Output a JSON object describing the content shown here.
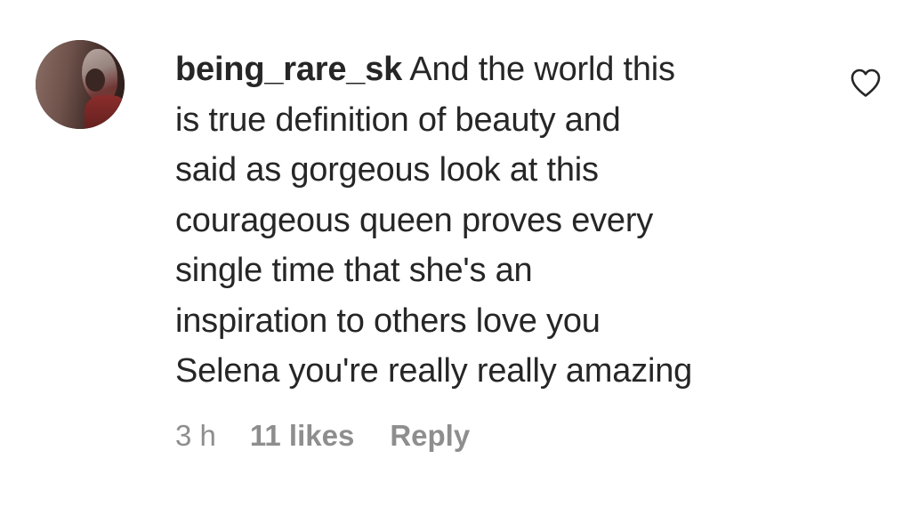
{
  "comment": {
    "avatar_icon": "user-avatar-photo",
    "username": "being_rare_sk",
    "text_lines": [
      "And the world this",
      "is true definition of beauty and",
      "said as gorgeous look at this",
      "courageous queen proves every",
      "single time that she's an",
      "inspiration to others love you",
      "Selena you're really really amazing"
    ],
    "time": "3 h",
    "likes": "11 likes",
    "reply_label": "Reply",
    "like_icon": "heart-outline-icon",
    "colors": {
      "text": "#262626",
      "meta": "#8e8e8e",
      "background": "#ffffff"
    }
  }
}
